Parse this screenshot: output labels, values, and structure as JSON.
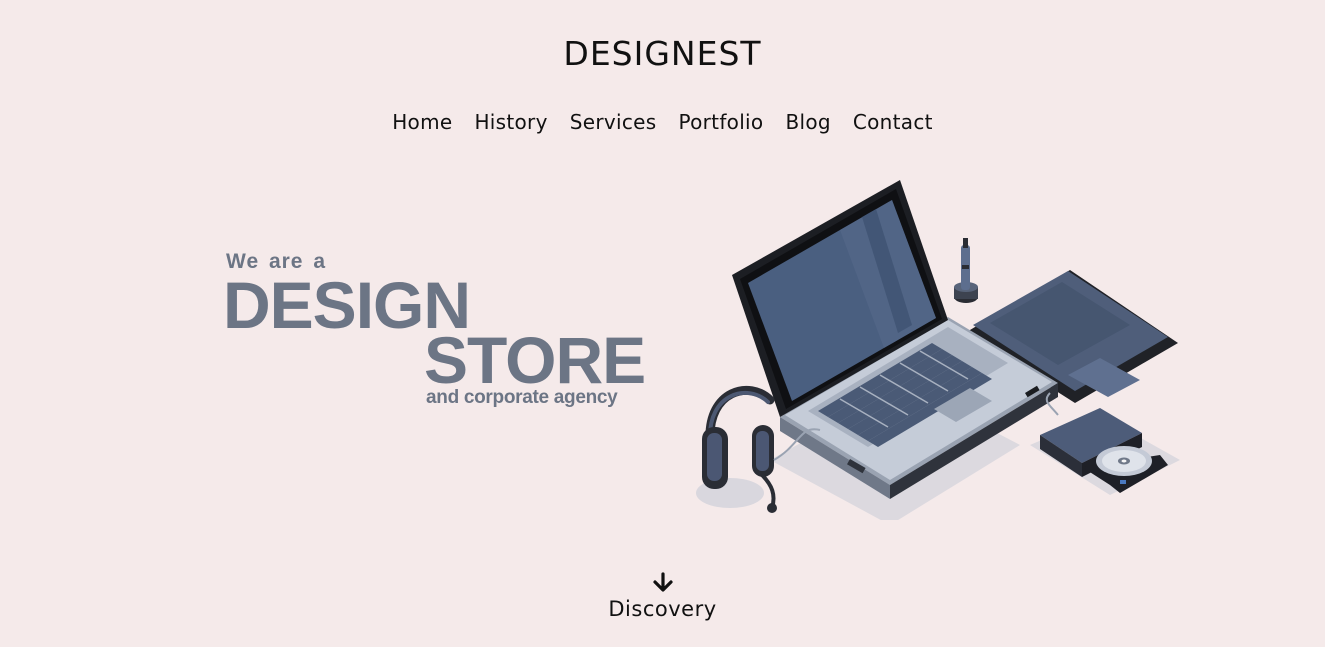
{
  "header": {
    "logo": "DESIGNEST"
  },
  "nav": {
    "items": [
      {
        "label": "Home"
      },
      {
        "label": "History"
      },
      {
        "label": "Services"
      },
      {
        "label": "Portfolio"
      },
      {
        "label": "Blog"
      },
      {
        "label": "Contact"
      }
    ]
  },
  "hero": {
    "line1": "We are a",
    "line2": "DESIGN",
    "line3": "STORE",
    "line4": "and corporate agency",
    "text_color": "#6c7585"
  },
  "illustration": {
    "description_icons": [
      "laptop-icon",
      "headphones-icon",
      "graphics-tablet-icon",
      "stylus-pen-icon",
      "external-dvd-drive-icon"
    ],
    "colors": {
      "screen": "#4d6283",
      "body": "#bcc3cf",
      "dark": "#23252b",
      "keys": "#4a5a76"
    }
  },
  "discovery": {
    "label": "Discovery",
    "icon": "arrow-down-icon"
  },
  "theme": {
    "background": "#f5eaea",
    "text": "#111111"
  }
}
